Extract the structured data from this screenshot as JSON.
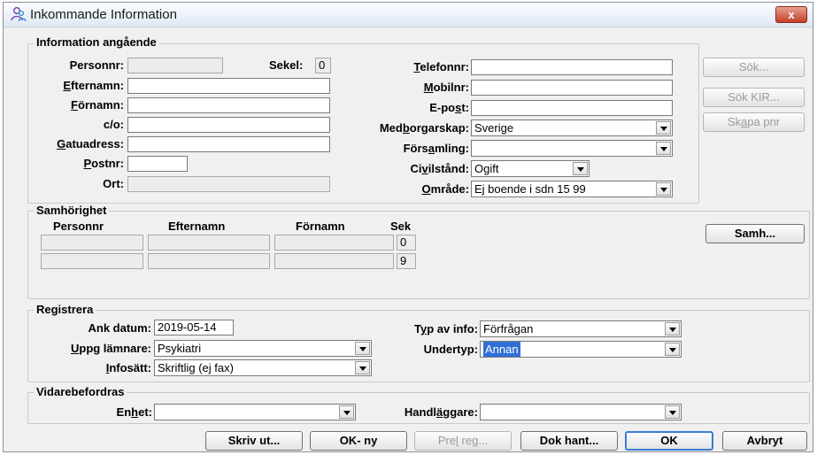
{
  "window": {
    "title": "Inkommande Information",
    "close_label": "x"
  },
  "info": {
    "group_title": "Information angående",
    "personnr_label": "Personnr:",
    "personnr_value": "",
    "sekel_label": "Sekel:",
    "sekel_value": "0",
    "efternamn_label_pre": "",
    "efternamn_label_u": "E",
    "efternamn_label_post": "fternamn:",
    "efternamn_value": "",
    "fornamn_label_u": "F",
    "fornamn_label_post": "örnamn:",
    "fornamn_value": "",
    "co_label": "c/o:",
    "co_value": "",
    "gatuadress_label_u": "G",
    "gatuadress_label_post": "atuadress:",
    "gatuadress_value": "",
    "postnr_label_u": "P",
    "postnr_label_post": "ostnr:",
    "postnr_value": "",
    "ort_label": "Ort:",
    "ort_value": "",
    "telefonnr_label_u": "T",
    "telefonnr_label_post": "elefonnr:",
    "telefonnr_value": "",
    "mobilnr_label_u": "M",
    "mobilnr_label_post": "obilnr:",
    "mobilnr_value": "",
    "epost_label_pre": "E-po",
    "epost_label_u": "s",
    "epost_label_post": "t:",
    "epost_value": "",
    "medborgarskap_label_pre": "Med",
    "medborgarskap_label_u": "b",
    "medborgarskap_label_post": "orgarskap:",
    "medborgarskap_value": "Sverige",
    "forsamling_label_pre": "Förs",
    "forsamling_label_u": "a",
    "forsamling_label_post": "mling:",
    "forsamling_value": "",
    "civilstand_label_pre": "Ci",
    "civilstand_label_u": "v",
    "civilstand_label_post": "ilstånd:",
    "civilstand_value": "Ogift",
    "omrade_label_u": "O",
    "omrade_label_post": "mråde:",
    "omrade_value": "Ej boende i sdn 15 99"
  },
  "side_buttons": {
    "sok": "Sök...",
    "sok_kir": "Sök KIR...",
    "skapa_pnr_pre": "Sk",
    "skapa_pnr_u": "a",
    "skapa_pnr_post": "pa pnr"
  },
  "samhorighet": {
    "group_title": "Samhörighet",
    "headers": [
      "Personnr",
      "Efternamn",
      "Förnamn",
      "Sek"
    ],
    "rows": [
      {
        "personnr": "",
        "efternamn": "",
        "fornamn": "",
        "sek": "0"
      },
      {
        "personnr": "",
        "efternamn": "",
        "fornamn": "",
        "sek": "9"
      }
    ],
    "samh_button": "Samh..."
  },
  "registrera": {
    "group_title": "Registrera",
    "ank_datum_label": "Ank datum:",
    "ank_datum_value": "2019-05-14",
    "uppg_label_u": "U",
    "uppg_label_post": "ppg lämnare:",
    "uppg_value": "Psykiatri",
    "infosatt_label_u": "I",
    "infosatt_label_post": "nfosätt:",
    "infosatt_value": "Skriftlig (ej fax)",
    "typ_label_pre": "T",
    "typ_label_u": "y",
    "typ_label_post": "p av info:",
    "typ_value": "Förfrågan",
    "undertyp_label": "Undertyp:",
    "undertyp_value": "Annan"
  },
  "vidare": {
    "group_title": "Vidarebefordras",
    "enhet_label_pre": "En",
    "enhet_label_u": "h",
    "enhet_label_post": "et:",
    "enhet_value": "",
    "handlaggare_label_pre": "Handl",
    "handlaggare_label_u": "ä",
    "handlaggare_label_post": "ggare:",
    "handlaggare_value": ""
  },
  "footer": {
    "skriv_ut": "Skriv ut...",
    "ok_ny": "OK- ny",
    "prel_reg_pre": "Pre",
    "prel_reg_u": "l",
    "prel_reg_post": " reg...",
    "dok_hant": "Dok hant...",
    "ok": "OK",
    "avbryt": "Avbryt"
  }
}
